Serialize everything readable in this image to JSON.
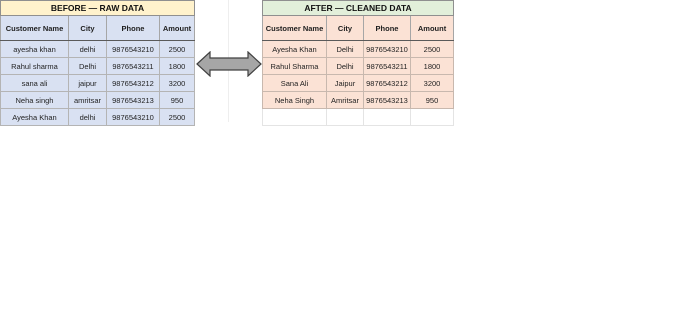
{
  "before": {
    "title": "BEFORE — RAW DATA",
    "headers": [
      "Customer Name",
      "City",
      "Phone",
      "Amount"
    ],
    "rows": [
      [
        "ayesha khan",
        "delhi",
        "9876543210",
        "2500"
      ],
      [
        "Rahul sharma",
        "Delhi",
        "9876543211",
        "1800"
      ],
      [
        "sana ali",
        "jaipur",
        "9876543212",
        "3200"
      ],
      [
        "Neha singh",
        "amritsar",
        "9876543213",
        "950"
      ],
      [
        "Ayesha Khan",
        "delhi",
        "9876543210",
        "2500"
      ]
    ]
  },
  "after": {
    "title": "AFTER — CLEANED DATA",
    "headers": [
      "Customer Name",
      "City",
      "Phone",
      "Amount"
    ],
    "rows": [
      [
        "Ayesha Khan",
        "Delhi",
        "9876543210",
        "2500"
      ],
      [
        "Rahul Sharma",
        "Delhi",
        "9876543211",
        "1800"
      ],
      [
        "Sana Ali",
        "Jaipur",
        "9876543212",
        "3200"
      ],
      [
        "Neha Singh",
        "Amritsar",
        "9876543213",
        "950"
      ]
    ]
  },
  "arrow": {
    "icon": "double-arrow-icon",
    "fill": "#a6a6a6",
    "stroke": "#404040"
  },
  "colors": {
    "before_title_bg": "#fff2cc",
    "before_body_bg": "#d9e1f2",
    "after_title_bg": "#e2efda",
    "after_body_bg": "#fbe2d5"
  }
}
